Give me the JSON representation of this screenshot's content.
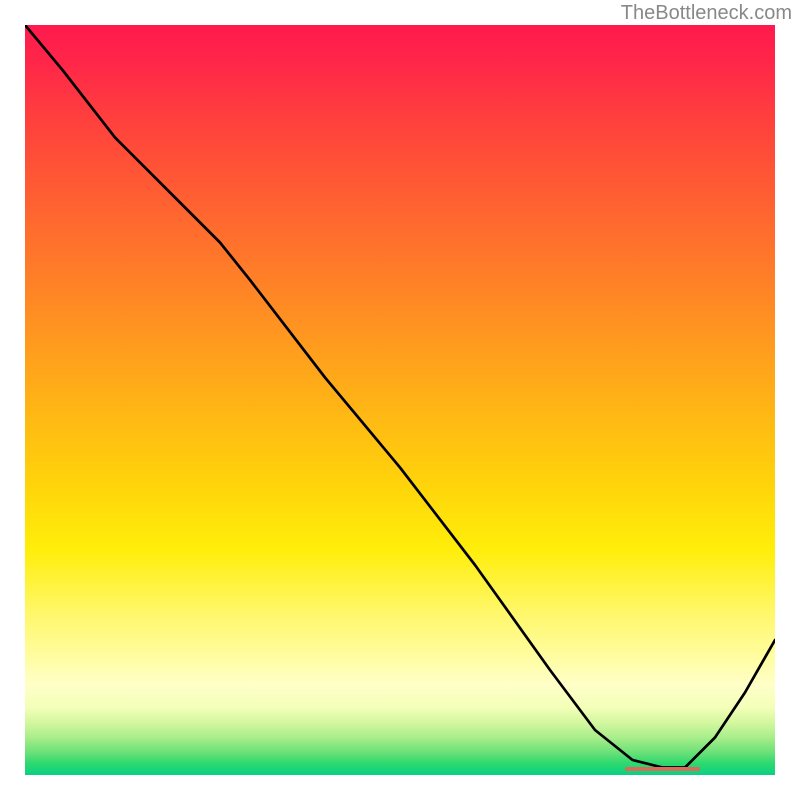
{
  "watermark": "TheBottleneck.com",
  "chart_data": {
    "type": "line",
    "title": "",
    "xlabel": "",
    "ylabel": "",
    "xlim": [
      0,
      100
    ],
    "ylim": [
      0,
      100
    ],
    "series": [
      {
        "name": "curve",
        "x": [
          0,
          5,
          12,
          20,
          26,
          30,
          40,
          50,
          60,
          70,
          76,
          81,
          85,
          88,
          92,
          96,
          100
        ],
        "values": [
          100,
          94,
          85,
          77,
          71,
          66,
          53,
          41,
          28,
          14,
          6,
          2,
          1,
          1,
          5,
          11,
          18
        ]
      }
    ],
    "marker": {
      "x_start": 80,
      "x_end": 90,
      "y": 0.8
    }
  }
}
